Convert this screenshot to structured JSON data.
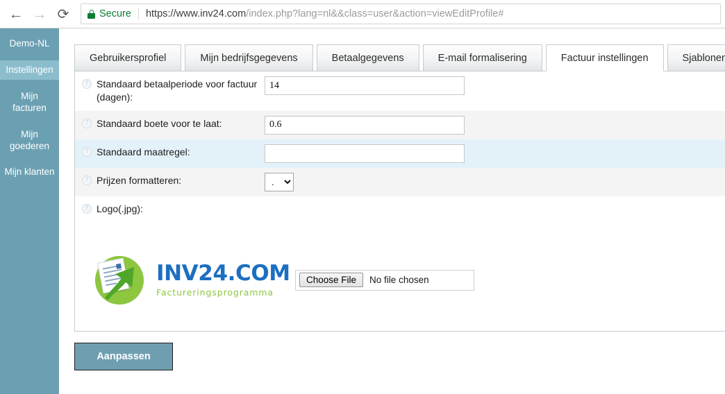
{
  "browser": {
    "back_icon": "back-arrow-icon",
    "forward_icon": "forward-arrow-icon",
    "reload_icon": "reload-icon",
    "lock_icon": "lock-icon",
    "secure_label": "Secure",
    "url_host": "https://www.inv24.com",
    "url_path": "/index.php?lang=nl&&class=user&action=viewEditProfile#",
    "colors": {
      "secure_green": "#0a7d33"
    }
  },
  "sidebar": {
    "items": [
      {
        "label": "Demo-NL",
        "active": false
      },
      {
        "label": "Instellingen",
        "active": true
      },
      {
        "label": "Mijn facturen",
        "active": false
      },
      {
        "label": "Mijn goederen",
        "active": false
      },
      {
        "label": "Mijn klanten",
        "active": false
      }
    ],
    "colors": {
      "background": "#6ba0b2",
      "active": "#8cbdcd"
    }
  },
  "tabs": [
    {
      "label": "Gebruikersprofiel",
      "active": false
    },
    {
      "label": "Mijn bedrijfsgegevens",
      "active": false
    },
    {
      "label": "Betaalgegevens",
      "active": false
    },
    {
      "label": "E-mail formalisering",
      "active": false
    },
    {
      "label": "Factuur instellingen",
      "active": true
    },
    {
      "label": "Sjablonen",
      "active": false
    }
  ],
  "form": {
    "help_glyph": "?",
    "rows": [
      {
        "label": "Standaard betaalperiode voor factuur (dagen):",
        "value": "14",
        "placeholder": "",
        "type": "text"
      },
      {
        "label": "Standaard boete voor te laat:",
        "value": "0.6",
        "placeholder": "",
        "type": "text"
      },
      {
        "label": "Standaard maatregel:",
        "value": "",
        "placeholder": "",
        "type": "text"
      },
      {
        "label": "Prijzen formatteren:",
        "value": ".",
        "options": [
          ".",
          ","
        ],
        "type": "select"
      },
      {
        "label": "Logo(.jpg):",
        "value": "",
        "type": "file"
      }
    ]
  },
  "logo": {
    "name": "INV24.COM",
    "tagline": "Factureringsprogramma",
    "colors": {
      "name": "#1d6fc0",
      "tagline": "#8dc63f",
      "circle": "#8dc63f"
    }
  },
  "file_input": {
    "button_label": "Choose File",
    "status_text": "No file chosen"
  },
  "submit": {
    "label": "Aanpassen",
    "colors": {
      "background": "#6f9eb0",
      "text": "#ffffff"
    }
  }
}
